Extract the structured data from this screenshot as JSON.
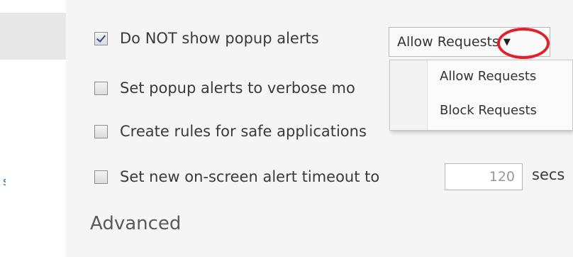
{
  "sidebar": {
    "selected_item": "",
    "fragment_text": "s"
  },
  "options": {
    "popup_alerts": {
      "label": "Do NOT show popup alerts",
      "checked": true
    },
    "verbose": {
      "label": "Set popup alerts to verbose mo",
      "checked": false
    },
    "safe_rules": {
      "label": "Create rules for safe applications",
      "checked": false
    },
    "timeout": {
      "label": "Set new on-screen alert timeout to",
      "checked": false,
      "value": "120",
      "unit": "secs"
    }
  },
  "request_select": {
    "value": "Allow Requests",
    "options": [
      "Allow Requests",
      "Block Requests"
    ]
  },
  "section": {
    "advanced_label": "Advanced"
  },
  "colors": {
    "annotation": "#e3202a",
    "panel_bg": "#f5f5f5",
    "selected_sidebar_bg": "#e7e7e7"
  },
  "icons": {
    "dropdown_arrow": "caret-down-icon",
    "annotation": "highlight-circle-icon"
  }
}
